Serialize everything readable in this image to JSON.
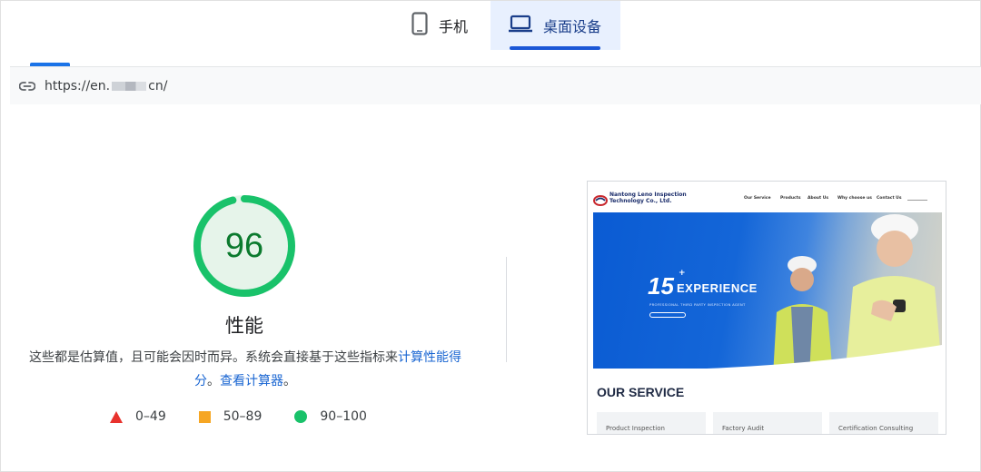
{
  "tabs": {
    "mobile_label": "手机",
    "desktop_label": "桌面设备",
    "active": "desktop"
  },
  "url": {
    "prefix": "https://en.",
    "suffix": "cn/"
  },
  "score": {
    "value": "96",
    "fraction": 0.96,
    "title": "性能",
    "description_prefix": "这些都是估算值，且可能会因时而异。系统会直接基于这些指标来",
    "description_link": "计算性能得分",
    "description_sep": "。",
    "calculator_link": "查看计算器",
    "description_end": "。"
  },
  "legend": [
    {
      "shape": "triangle",
      "label": "0–49",
      "color": "#e8322d"
    },
    {
      "shape": "square",
      "label": "50–89",
      "color": "#f6a623"
    },
    {
      "shape": "circle",
      "label": "90–100",
      "color": "#19c26a"
    }
  ],
  "colors": {
    "good": "#19c26a",
    "good_bg": "#e6f4ea",
    "link": "#1a66d2",
    "tab_active_bg": "#e8f0fe"
  },
  "screenshot": {
    "brand_line1": "Nantong Leno Inspection",
    "brand_line2": "Technology Co., Ltd.",
    "nav": [
      "Our Service",
      "Products",
      "About Us",
      "Why choose us",
      "Contact Us"
    ],
    "hero_number": "15",
    "hero_plus": "+",
    "hero_title": "EXPERIENCE",
    "hero_subtitle": "PROFESSIONAL THIRD PARTY INSPECTION AGENT",
    "section_title": "OUR SERVICE",
    "cards": [
      "Product Inspection",
      "Factory Audit",
      "Certification Consulting"
    ]
  }
}
